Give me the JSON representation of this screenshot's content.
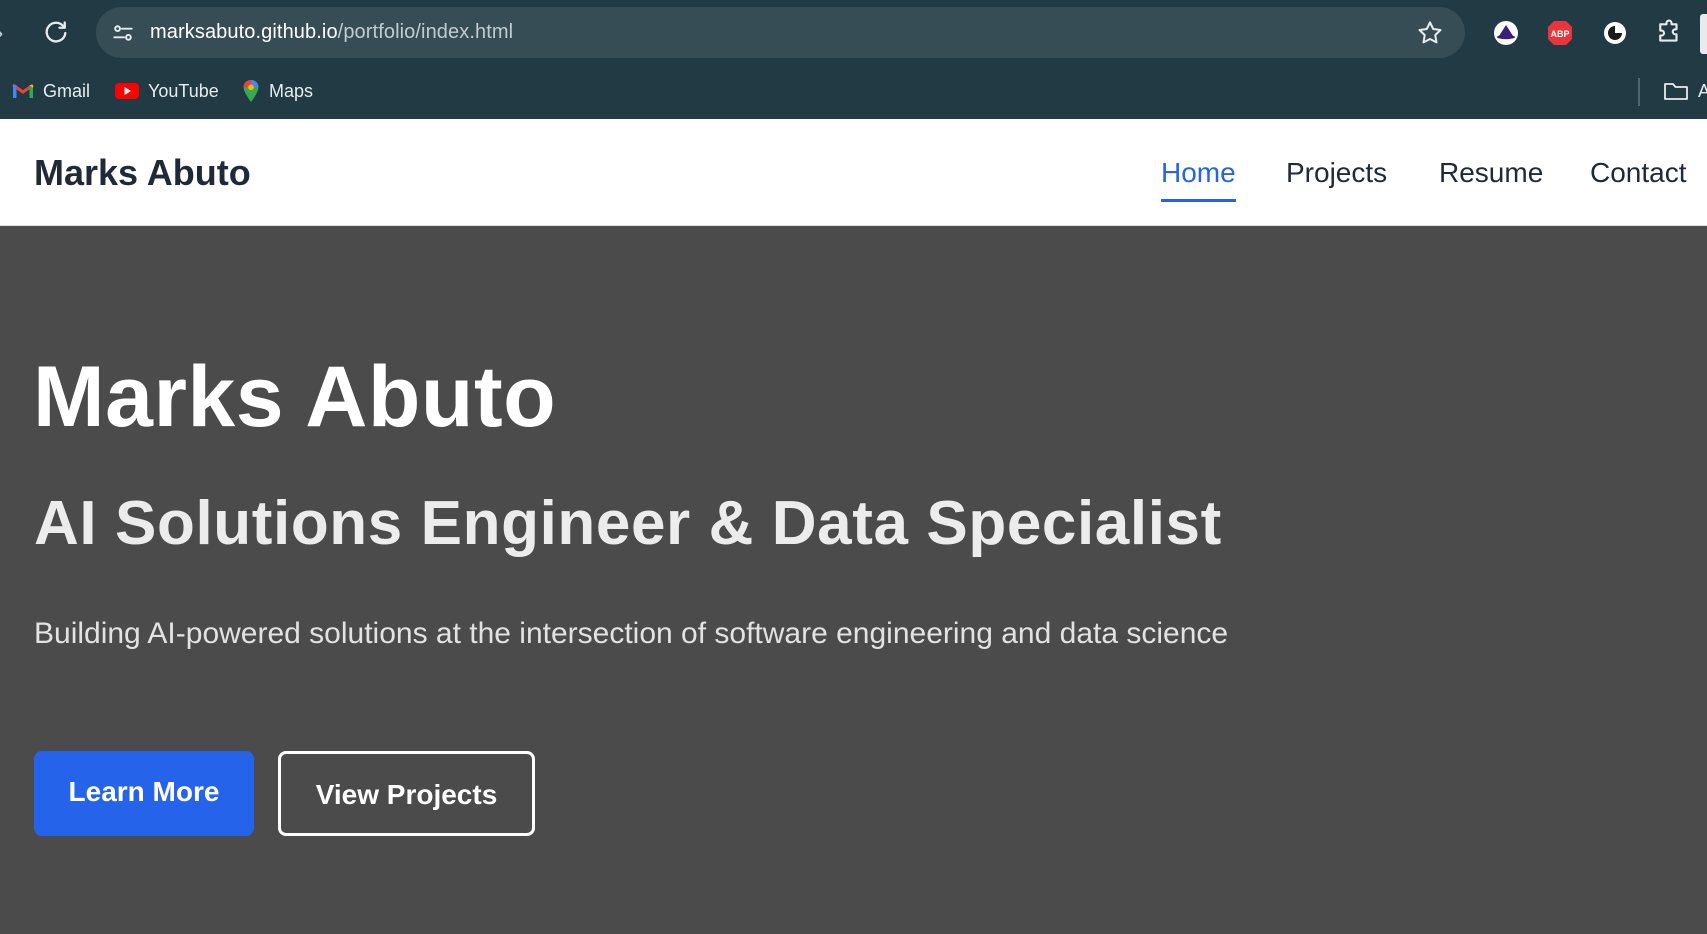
{
  "browser": {
    "url_host": "marksabuto.github.io",
    "url_path": "/portfolio/index.html",
    "bookmarks": [
      {
        "label": "Gmail",
        "icon": "gmail-icon"
      },
      {
        "label": "YouTube",
        "icon": "youtube-icon"
      },
      {
        "label": "Maps",
        "icon": "maps-icon"
      }
    ],
    "extensions": {
      "abp_label": "ABP"
    },
    "folder_label": "A"
  },
  "site": {
    "brand": "Marks Abuto",
    "nav": [
      {
        "label": "Home",
        "active": true
      },
      {
        "label": "Projects",
        "active": false
      },
      {
        "label": "Resume",
        "active": false
      },
      {
        "label": "Contact",
        "active": false
      }
    ]
  },
  "hero": {
    "title": "Marks Abuto",
    "subtitle": "AI Solutions Engineer & Data Specialist",
    "description": "Building AI-powered solutions at the intersection of software engineering and data science",
    "primary_button": "Learn More",
    "secondary_button": "View Projects"
  },
  "colors": {
    "accent": "#2563eb",
    "hero_bg": "#4b4b4b",
    "chrome_bg": "#213a44"
  }
}
